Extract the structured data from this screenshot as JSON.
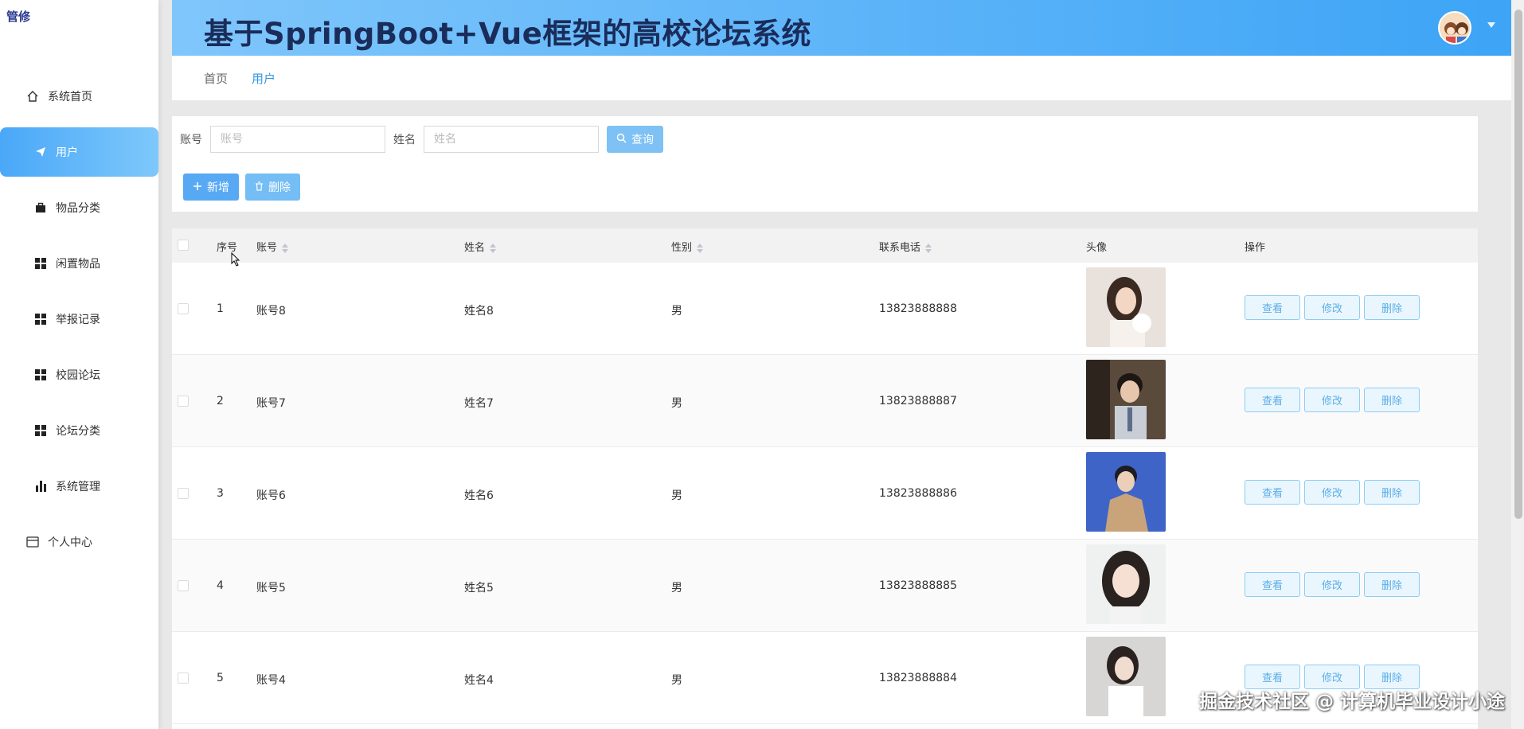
{
  "app": {
    "logo": "管修",
    "title": "基于SpringBoot+Vue框架的高校论坛系统"
  },
  "sidebar": {
    "items": [
      {
        "label": "系统首页",
        "icon": "home-icon"
      },
      {
        "label": "用户",
        "icon": "paper-plane-icon",
        "active": true
      },
      {
        "label": "物品分类",
        "icon": "briefcase-icon"
      },
      {
        "label": "闲置物品",
        "icon": "grid-icon"
      },
      {
        "label": "举报记录",
        "icon": "grid-icon"
      },
      {
        "label": "校园论坛",
        "icon": "grid-icon"
      },
      {
        "label": "论坛分类",
        "icon": "grid-icon"
      },
      {
        "label": "系统管理",
        "icon": "bar-chart-icon"
      },
      {
        "label": "个人中心",
        "icon": "card-icon"
      }
    ]
  },
  "breadcrumb": {
    "home": "首页",
    "current": "用户"
  },
  "search": {
    "account_label": "账号",
    "account_placeholder": "账号",
    "name_label": "姓名",
    "name_placeholder": "姓名",
    "query_label": "查询"
  },
  "actions": {
    "add_label": "新增",
    "delete_label": "删除"
  },
  "table": {
    "headers": {
      "index": "序号",
      "account": "账号",
      "name": "姓名",
      "gender": "性别",
      "phone": "联系电话",
      "avatar": "头像",
      "ops": "操作"
    },
    "rows": [
      {
        "index": "1",
        "account": "账号8",
        "name": "姓名8",
        "gender": "男",
        "phone": "13823888888"
      },
      {
        "index": "2",
        "account": "账号7",
        "name": "姓名7",
        "gender": "男",
        "phone": "13823888887"
      },
      {
        "index": "3",
        "account": "账号6",
        "name": "姓名6",
        "gender": "男",
        "phone": "13823888886"
      },
      {
        "index": "4",
        "account": "账号5",
        "name": "姓名5",
        "gender": "男",
        "phone": "13823888885"
      },
      {
        "index": "5",
        "account": "账号4",
        "name": "姓名4",
        "gender": "男",
        "phone": "13823888884"
      }
    ],
    "op_labels": {
      "view": "查看",
      "edit": "修改",
      "delete": "删除"
    }
  },
  "watermark": "掘金技术社区 @ 计算机毕业设计小途",
  "colors": {
    "accent": "#4aa8f8",
    "header_start": "#7fc6fb",
    "header_end": "#3da4f6",
    "title": "#1a2c5a"
  }
}
